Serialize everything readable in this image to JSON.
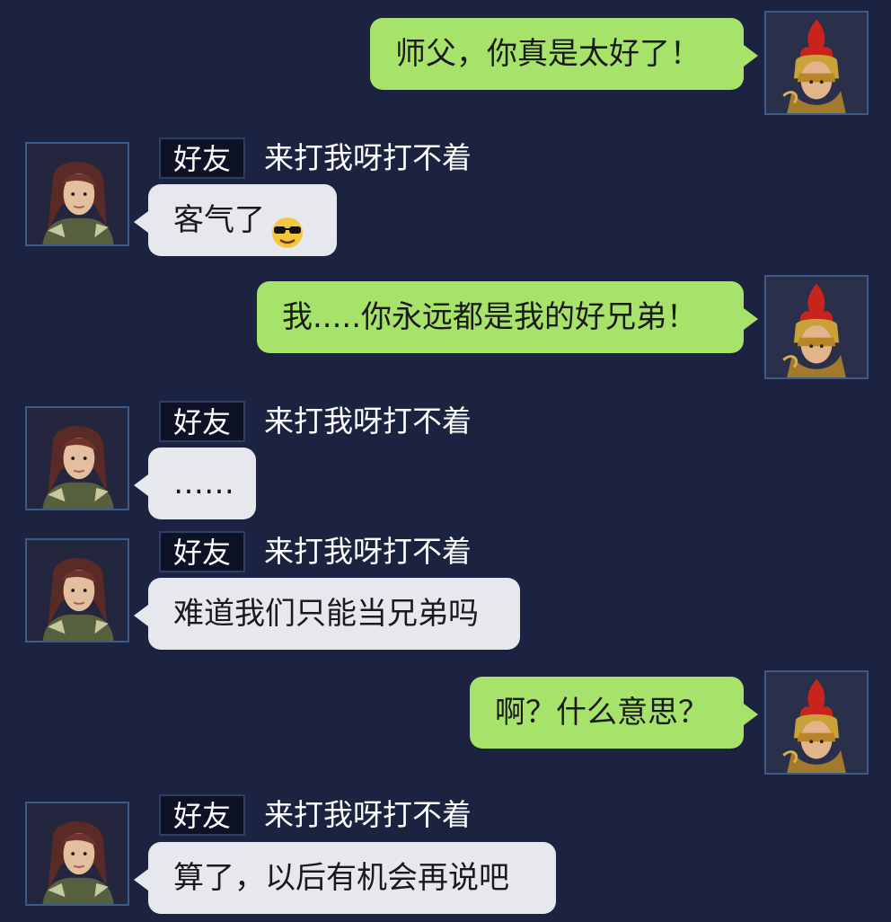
{
  "friend_tag": "好友",
  "friend_name": "来打我呀打不着",
  "messages": [
    {
      "from": "me",
      "text": "师父，你真是太好了！"
    },
    {
      "from": "them",
      "text": "客气了",
      "emoji": "sunglasses-emoji"
    },
    {
      "from": "me",
      "text": "我.....你永远都是我的好兄弟！"
    },
    {
      "from": "them",
      "text": "……"
    },
    {
      "from": "them",
      "text": "难道我们只能当兄弟吗"
    },
    {
      "from": "me",
      "text": "啊？什么意思？"
    },
    {
      "from": "them",
      "text": "算了，以后有机会再说吧"
    }
  ],
  "colors": {
    "background": "#1b2341",
    "my_bubble": "#a7e36b",
    "their_bubble": "#e6e8ee",
    "avatar_border": "#3c5b8a"
  },
  "icons": {
    "my_avatar": "red-plumed-warrior-avatar",
    "their_avatar": "long-haired-hero-avatar"
  }
}
